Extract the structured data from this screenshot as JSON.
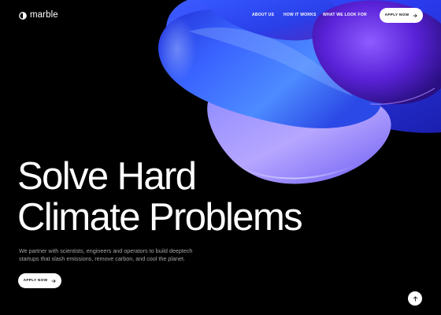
{
  "brand": {
    "name": "marble",
    "logo_icon": "half-circle-logo-icon"
  },
  "nav": {
    "links": [
      {
        "label": "ABOUT US"
      },
      {
        "label": "HOW IT WORKS"
      },
      {
        "label": "WHAT WE LOOK FOR"
      }
    ],
    "cta_label": "APPLY NOW",
    "cta_icon": "arrow-right-icon"
  },
  "hero": {
    "headline_line1": "Solve Hard",
    "headline_line2": "Climate Problems",
    "tagline_line1": "We partner with scientists, engineers and operators to build deeptech",
    "tagline_line2": "startups that slash emissions, remove carbon, and cool the planet.",
    "cta_label": "APPLY NOW",
    "cta_icon": "arrow-right-icon",
    "artwork": "abstract-3d-shape"
  },
  "scroll_top": {
    "icon": "arrow-up-icon"
  },
  "colors": {
    "background": "#000000",
    "text": "#ffffff",
    "muted_text": "#a6a6a6",
    "button_bg": "#ffffff",
    "button_text": "#111111",
    "shape_blue": "#2f47ff",
    "shape_violet": "#6a2de0",
    "shape_lavender": "#b7a8ff"
  }
}
